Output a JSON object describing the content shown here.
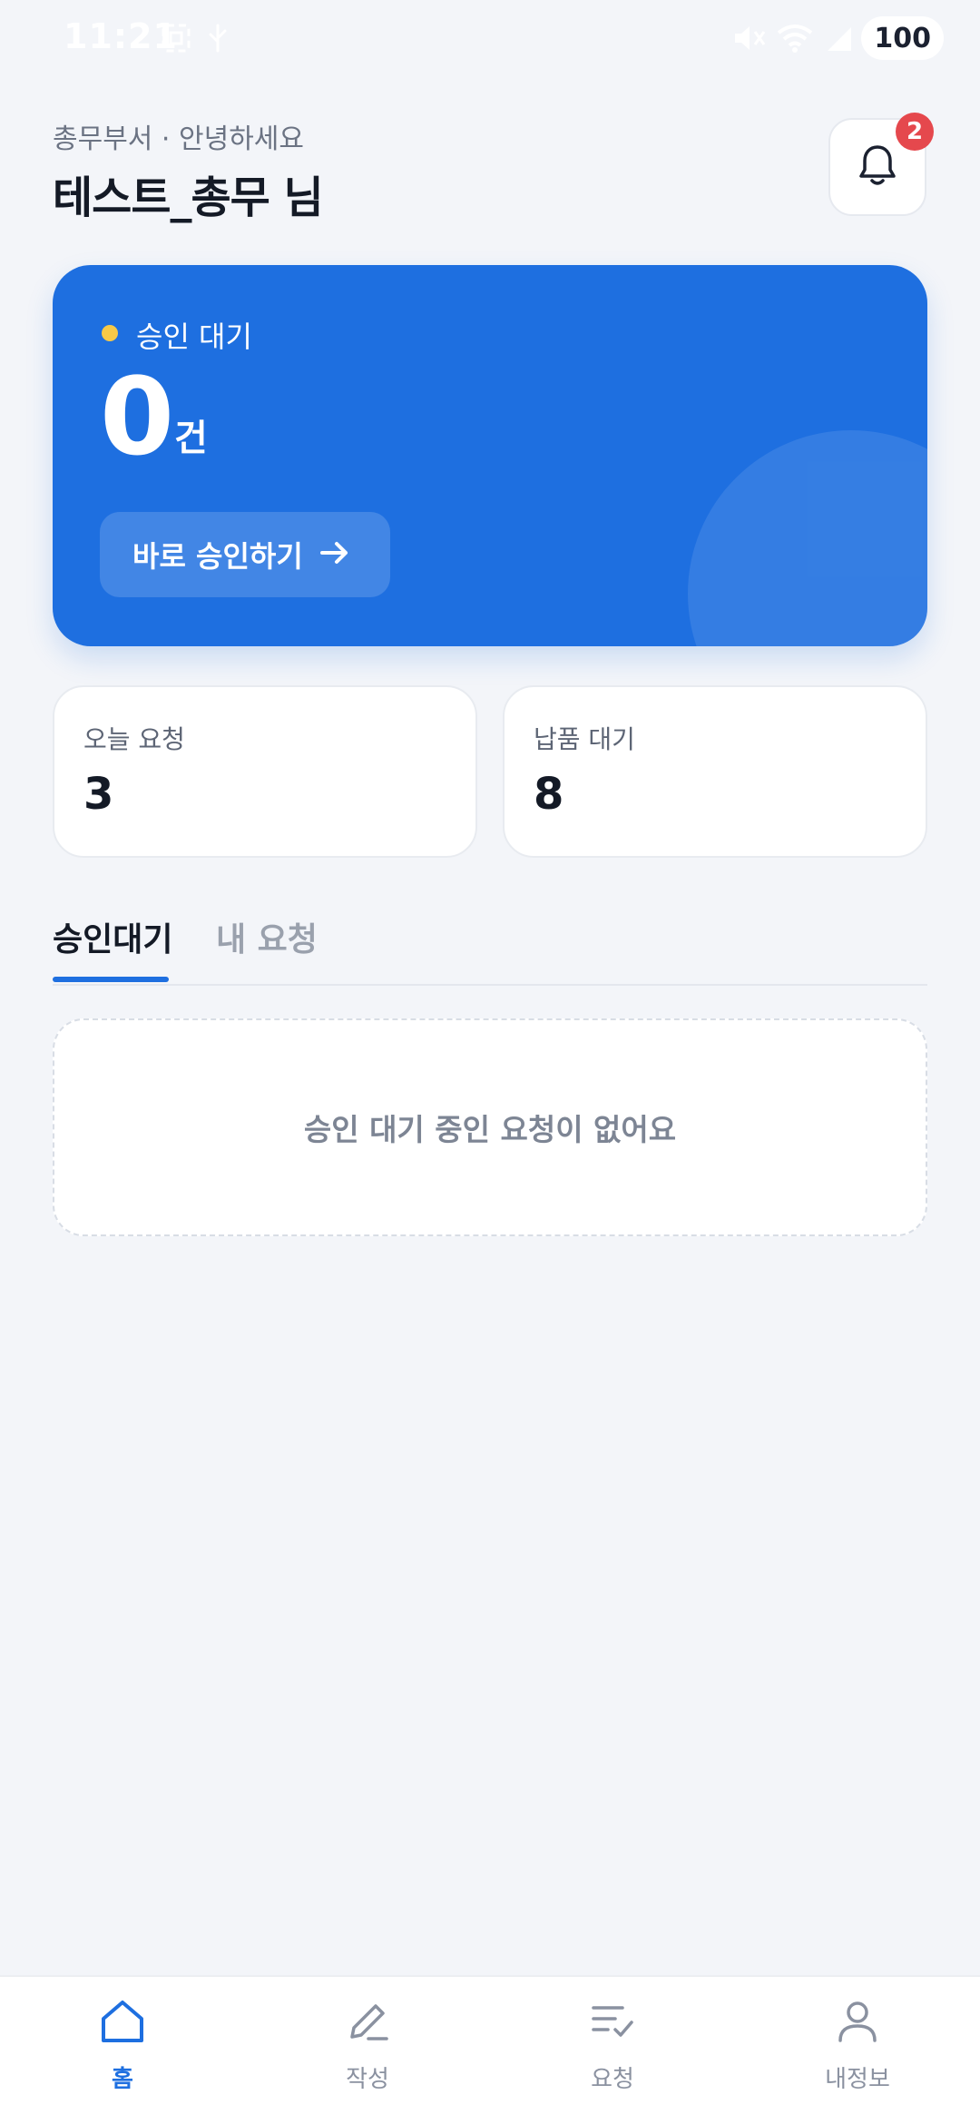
{
  "status_bar": {
    "time": "11:21",
    "battery": "100",
    "icons": [
      "screenshot-icon",
      "usb-icon",
      "mute-icon",
      "wifi-icon",
      "signal-icon",
      "battery-icon"
    ]
  },
  "header": {
    "greeting": "총무부서 · 안녕하세요",
    "username": "테스트_총무 님",
    "notification_count": "2"
  },
  "approval_card": {
    "label": "승인 대기",
    "count": "0",
    "unit": "건",
    "button_label": "바로 승인하기",
    "background_color": "#1e6fe0",
    "dot_color": "#f7c948"
  },
  "stats": [
    {
      "label": "오늘 요청",
      "value": "3"
    },
    {
      "label": "납품 대기",
      "value": "8"
    }
  ],
  "tabs": [
    {
      "label": "승인대기",
      "active": true
    },
    {
      "label": "내 요청",
      "active": false
    }
  ],
  "empty_state": {
    "message": "승인 대기 중인 요청이 없어요"
  },
  "bottom_nav": [
    {
      "label": "홈",
      "icon": "home-icon",
      "active": true
    },
    {
      "label": "작성",
      "icon": "pencil-icon",
      "active": false
    },
    {
      "label": "요청",
      "icon": "list-check-icon",
      "active": false
    },
    {
      "label": "내정보",
      "icon": "user-icon",
      "active": false
    }
  ],
  "colors": {
    "accent": "#1e6fe0",
    "badge": "#e5484d",
    "background": "#f3f5f9"
  }
}
